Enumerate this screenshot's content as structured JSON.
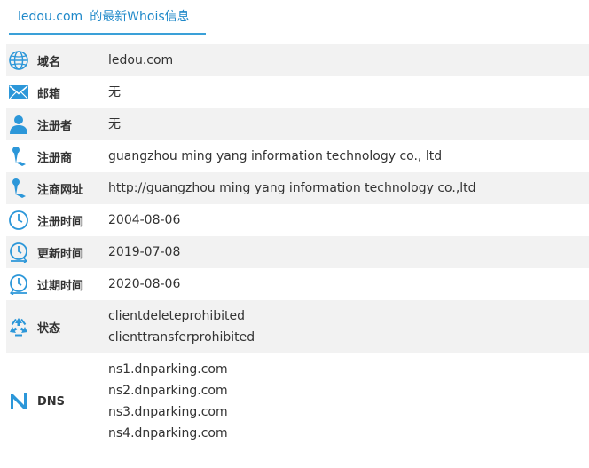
{
  "header": {
    "domain": "ledou.com",
    "title_suffix": "的最新Whois信息"
  },
  "colors": {
    "accent": "#1e88c9",
    "icon": "#2c97d9",
    "row_alt": "#f2f2f2"
  },
  "rows": [
    {
      "label": "域名",
      "icon": "globe-icon",
      "values": [
        "ledou.com"
      ]
    },
    {
      "label": "邮箱",
      "icon": "envelope-icon",
      "values": [
        "无"
      ]
    },
    {
      "label": "注册者",
      "icon": "user-icon",
      "values": [
        "无"
      ]
    },
    {
      "label": "注册商",
      "icon": "pin-icon",
      "values": [
        "guangzhou ming yang information technology co., ltd"
      ]
    },
    {
      "label": "注商网址",
      "icon": "pin-icon",
      "values": [
        "http://guangzhou ming yang information technology co.,ltd"
      ]
    },
    {
      "label": "注册时间",
      "icon": "clock-icon",
      "values": [
        "2004-08-06"
      ]
    },
    {
      "label": "更新时间",
      "icon": "clock-refresh-icon",
      "values": [
        "2019-07-08"
      ]
    },
    {
      "label": "过期时间",
      "icon": "clock-expire-icon",
      "values": [
        "2020-08-06"
      ]
    },
    {
      "label": "状态",
      "icon": "recycle-icon",
      "values": [
        "clientdeleteprohibited",
        "clienttransferprohibited"
      ]
    },
    {
      "label": "DNS",
      "icon": "dns-icon",
      "values": [
        "ns1.dnparking.com",
        "ns2.dnparking.com",
        "ns3.dnparking.com",
        "ns4.dnparking.com"
      ]
    }
  ]
}
